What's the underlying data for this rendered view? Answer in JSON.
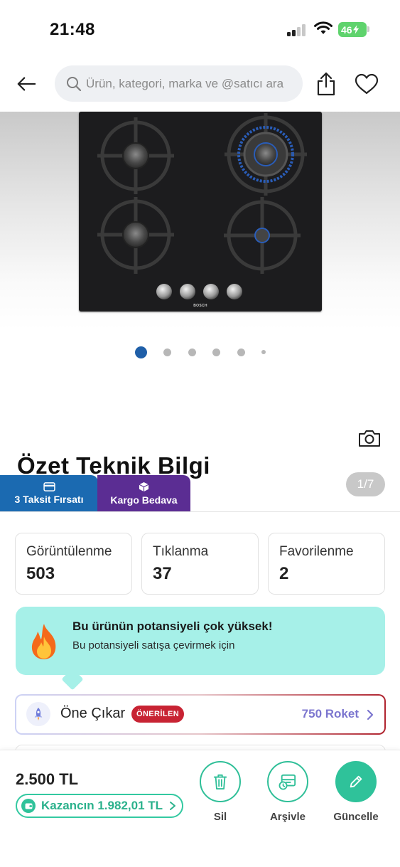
{
  "status_bar": {
    "time": "21:48",
    "battery": "46"
  },
  "header": {
    "search_placeholder": "Ürün, kategori, marka ve @satıcı ara"
  },
  "product": {
    "brand_on_image": "BOSCH",
    "image_counter": "1/7",
    "carousel": {
      "total_dots": 6,
      "active_index": 0
    }
  },
  "section": {
    "title": "Özet Teknik Bilgi"
  },
  "badges": {
    "taksit": "3 Taksit Fırsatı",
    "kargo": "Kargo Bedava"
  },
  "stats": [
    {
      "label": "Görüntülenme",
      "value": "503"
    },
    {
      "label": "Tıklanma",
      "value": "37"
    },
    {
      "label": "Favorilenme",
      "value": "2"
    }
  ],
  "potential": {
    "title": "Bu ürünün potansiyeli çok yüksek!",
    "subtitle": "Bu potansiyeli satışa çevirmek için"
  },
  "promote": {
    "label": "Öne Çıkar",
    "tag": "ÖNERİLEN",
    "amount": "750 Roket"
  },
  "bottom": {
    "price": "2.500 TL",
    "earnings": "Kazancın 1.982,01 TL",
    "actions": [
      {
        "label": "Sil",
        "icon": "trash-icon"
      },
      {
        "label": "Arşivle",
        "icon": "archive-icon"
      },
      {
        "label": "Güncelle",
        "icon": "pencil-icon"
      }
    ]
  },
  "colors": {
    "accent_teal": "#2fc29a",
    "taksit_blue": "#1b6ab1",
    "kargo_purple": "#5b2d93",
    "recommended_red": "#c82333",
    "roket_purple": "#7c76cf",
    "banner_mint": "#a6f0e8"
  }
}
